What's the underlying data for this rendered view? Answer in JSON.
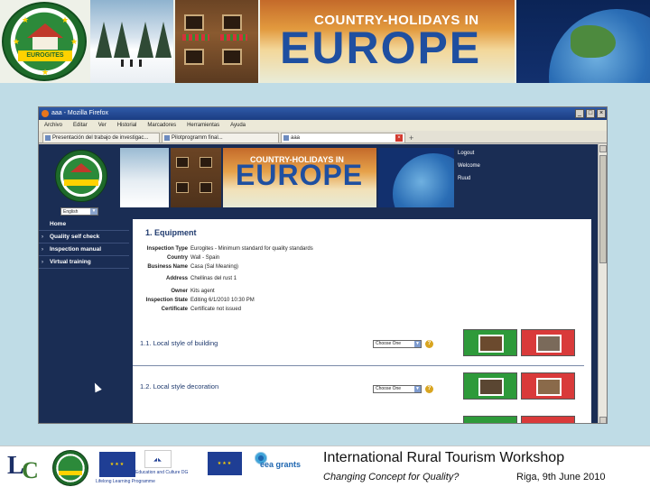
{
  "banner": {
    "logo_text": "EUROGITES",
    "title_small": "COUNTRY-HOLIDAYS IN",
    "title_big": "EUROPE"
  },
  "browser": {
    "window_title": "aaa - Mozilla Firefox",
    "menu": [
      "Archivo",
      "Editar",
      "Ver",
      "Historial",
      "Marcadores",
      "Herramientas",
      "Ayuda"
    ],
    "tabs": [
      {
        "label": "Presentación del trabajo de investigac...",
        "active": false
      },
      {
        "label": "Pilotprogramm final...",
        "active": false
      },
      {
        "label": "aaa",
        "active": true
      }
    ],
    "new_tab": "+",
    "win_buttons": [
      "_",
      "□",
      "×"
    ]
  },
  "site": {
    "logo_text": "EUROGITES",
    "title_small": "COUNTRY-HOLIDAYS IN",
    "title_big": "EUROPE",
    "links": [
      "Logout",
      "Welcome",
      "Ruud"
    ],
    "language": "English",
    "nav": [
      "Home",
      "Quality self check",
      "Inspection manual",
      "Virtual training"
    ]
  },
  "content": {
    "section_title": "1. Equipment",
    "fields": [
      {
        "key": "Inspection Type",
        "value": "Eurogites - Minimum standard for quality standards"
      },
      {
        "key": "Country",
        "value": "Wall - Spain"
      },
      {
        "key": "Business Name",
        "value": "Casa (Sal Meaning)"
      },
      {
        "key": "Address",
        "value": "Chellinas del rust 1"
      },
      {
        "key": "Owner",
        "value": "Kits agent"
      },
      {
        "key": "Inspection State",
        "value": "Editing 6/1/2010 10:30 PM"
      },
      {
        "key": "Certificate",
        "value": "Certificate not issued"
      }
    ],
    "questions": [
      {
        "label": "1.1. Local style of building",
        "select": "Choose One"
      },
      {
        "label": "1.2. Local style decoration",
        "select": "Choose One"
      }
    ],
    "help_glyph": "?"
  },
  "footer": {
    "lc_letters": [
      "L",
      "C"
    ],
    "logo_text": "EUROGITES",
    "llp_caption": "Lifelong Learning Programme",
    "edu_caption": "Education and Culture DG",
    "eea_text": "eea grants",
    "workshop_title": "International Rural Tourism Workshop",
    "subtitle": "Changing Concept for Quality?",
    "place_date": "Riga, 9th June 2010"
  },
  "colors": {
    "accent_navy": "#1a2d54",
    "good": "#2e9a3a",
    "bad": "#d93a3a"
  }
}
